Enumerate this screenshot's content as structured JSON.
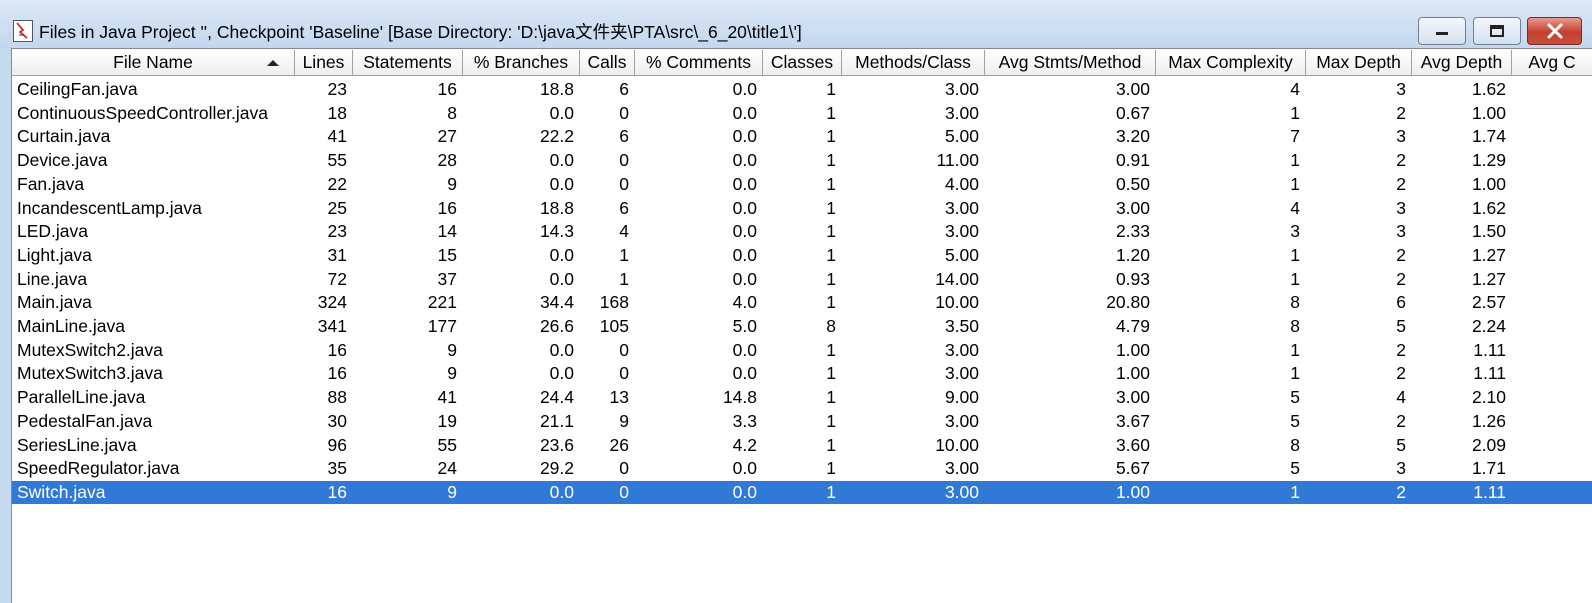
{
  "window": {
    "title": "Files in Java Project '', Checkpoint 'Baseline'  [Base Directory: 'D:\\java文件夹\\PTA\\src\\_6_20\\title1\\']",
    "icon": "document-chart-icon",
    "controls": [
      "minimize",
      "maximize",
      "close"
    ]
  },
  "table": {
    "sorted_by": "File Name",
    "sort_direction": "ascending",
    "columns": [
      "File Name",
      "Lines",
      "Statements",
      "% Branches",
      "Calls",
      "% Comments",
      "Classes",
      "Methods/Class",
      "Avg Stmts/Method",
      "Max Complexity",
      "Max Depth",
      "Avg Depth",
      "Avg C"
    ],
    "rows": [
      [
        "CeilingFan.java",
        "23",
        "16",
        "18.8",
        "6",
        "0.0",
        "1",
        "3.00",
        "3.00",
        "4",
        "3",
        "1.62"
      ],
      [
        "ContinuousSpeedController.java",
        "18",
        "8",
        "0.0",
        "0",
        "0.0",
        "1",
        "3.00",
        "0.67",
        "1",
        "2",
        "1.00"
      ],
      [
        "Curtain.java",
        "41",
        "27",
        "22.2",
        "6",
        "0.0",
        "1",
        "5.00",
        "3.20",
        "7",
        "3",
        "1.74"
      ],
      [
        "Device.java",
        "55",
        "28",
        "0.0",
        "0",
        "0.0",
        "1",
        "11.00",
        "0.91",
        "1",
        "2",
        "1.29"
      ],
      [
        "Fan.java",
        "22",
        "9",
        "0.0",
        "0",
        "0.0",
        "1",
        "4.00",
        "0.50",
        "1",
        "2",
        "1.00"
      ],
      [
        "IncandescentLamp.java",
        "25",
        "16",
        "18.8",
        "6",
        "0.0",
        "1",
        "3.00",
        "3.00",
        "4",
        "3",
        "1.62"
      ],
      [
        "LED.java",
        "23",
        "14",
        "14.3",
        "4",
        "0.0",
        "1",
        "3.00",
        "2.33",
        "3",
        "3",
        "1.50"
      ],
      [
        "Light.java",
        "31",
        "15",
        "0.0",
        "1",
        "0.0",
        "1",
        "5.00",
        "1.20",
        "1",
        "2",
        "1.27"
      ],
      [
        "Line.java",
        "72",
        "37",
        "0.0",
        "1",
        "0.0",
        "1",
        "14.00",
        "0.93",
        "1",
        "2",
        "1.27"
      ],
      [
        "Main.java",
        "324",
        "221",
        "34.4",
        "168",
        "4.0",
        "1",
        "10.00",
        "20.80",
        "8",
        "6",
        "2.57"
      ],
      [
        "MainLine.java",
        "341",
        "177",
        "26.6",
        "105",
        "5.0",
        "8",
        "3.50",
        "4.79",
        "8",
        "5",
        "2.24"
      ],
      [
        "MutexSwitch2.java",
        "16",
        "9",
        "0.0",
        "0",
        "0.0",
        "1",
        "3.00",
        "1.00",
        "1",
        "2",
        "1.11"
      ],
      [
        "MutexSwitch3.java",
        "16",
        "9",
        "0.0",
        "0",
        "0.0",
        "1",
        "3.00",
        "1.00",
        "1",
        "2",
        "1.11"
      ],
      [
        "ParallelLine.java",
        "88",
        "41",
        "24.4",
        "13",
        "14.8",
        "1",
        "9.00",
        "3.00",
        "5",
        "4",
        "2.10"
      ],
      [
        "PedestalFan.java",
        "30",
        "19",
        "21.1",
        "9",
        "3.3",
        "1",
        "3.00",
        "3.67",
        "5",
        "2",
        "1.26"
      ],
      [
        "SeriesLine.java",
        "96",
        "55",
        "23.6",
        "26",
        "4.2",
        "1",
        "10.00",
        "3.60",
        "8",
        "5",
        "2.09"
      ],
      [
        "SpeedRegulator.java",
        "35",
        "24",
        "29.2",
        "0",
        "0.0",
        "1",
        "3.00",
        "5.67",
        "5",
        "3",
        "1.71"
      ],
      [
        "Switch.java",
        "16",
        "9",
        "0.0",
        "0",
        "0.0",
        "1",
        "3.00",
        "1.00",
        "1",
        "2",
        "1.11"
      ]
    ],
    "selected_row": 17,
    "selection_color": "#3079d6"
  }
}
